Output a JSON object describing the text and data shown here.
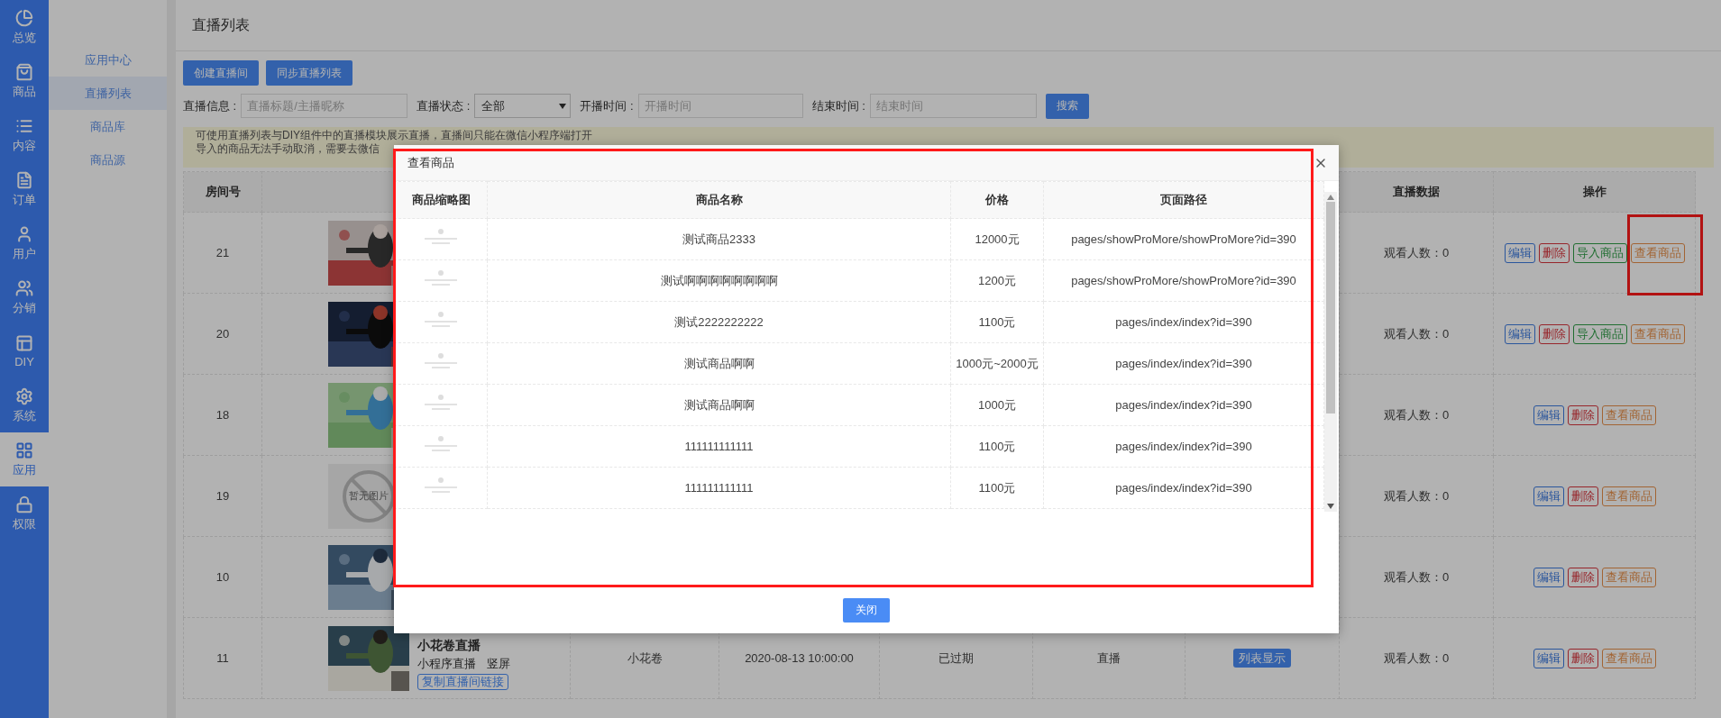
{
  "rail": [
    {
      "label": "总览",
      "selected": false
    },
    {
      "label": "商品",
      "selected": false
    },
    {
      "label": "内容",
      "selected": false
    },
    {
      "label": "订单",
      "selected": false
    },
    {
      "label": "用户",
      "selected": false
    },
    {
      "label": "分销",
      "selected": false
    },
    {
      "label": "DIY",
      "selected": false
    },
    {
      "label": "系统",
      "selected": false
    },
    {
      "label": "应用",
      "selected": true
    },
    {
      "label": "权限",
      "selected": false
    }
  ],
  "subnav": [
    {
      "label": "应用中心",
      "selected": false
    },
    {
      "label": "直播列表",
      "selected": true
    },
    {
      "label": "商品库",
      "selected": false
    },
    {
      "label": "商品源",
      "selected": false
    }
  ],
  "page": {
    "title": "直播列表"
  },
  "toolbar": [
    "创建直播间",
    "同步直播列表"
  ],
  "filters": {
    "info_label": "直播信息 :",
    "info_placeholder": "直播标题/主播昵称",
    "status_label": "直播状态 :",
    "status_value": "全部",
    "start_label": "开播时间 :",
    "start_placeholder": "开播时间",
    "end_label": "结束时间 :",
    "end_placeholder": "结束时间",
    "search": "搜索"
  },
  "notice": [
    "可使用直播列表与DIY组件中的直播模块展示直播，直播间只能在微信小程序端打开",
    "导入的商品无法手动取消，需要去微信"
  ],
  "table": {
    "columns": {
      "room": "房间号",
      "data": "直播数据",
      "ops": "操作"
    },
    "rows": [
      {
        "room": "21",
        "cover": {
          "kind": "picture"
        },
        "viewers": "观看人数：0",
        "actions": [
          {
            "kind": "edit",
            "label": "编辑",
            "framed": false
          },
          {
            "kind": "delete",
            "label": "删除",
            "framed": false
          },
          {
            "kind": "import",
            "label": "导入商品",
            "framed": false
          },
          {
            "kind": "view",
            "label": "查看商品",
            "framed": true
          }
        ]
      },
      {
        "room": "20",
        "cover": {
          "kind": "picture"
        },
        "viewers": "观看人数：0",
        "actions": [
          {
            "kind": "edit",
            "label": "编辑",
            "framed": false
          },
          {
            "kind": "delete",
            "label": "删除",
            "framed": false
          },
          {
            "kind": "import",
            "label": "导入商品",
            "framed": false
          },
          {
            "kind": "view",
            "label": "查看商品",
            "framed": false
          }
        ]
      },
      {
        "room": "18",
        "cover": {
          "kind": "picture"
        },
        "viewers": "观看人数：0",
        "actions": [
          {
            "kind": "edit",
            "label": "编辑",
            "framed": false
          },
          {
            "kind": "delete",
            "label": "删除",
            "framed": false
          },
          {
            "kind": "view",
            "label": "查看商品",
            "framed": false
          }
        ]
      },
      {
        "room": "19",
        "cover": {
          "kind": "placeholder",
          "text": "暂无图片"
        },
        "viewers": "观看人数：0",
        "actions": [
          {
            "kind": "edit",
            "label": "编辑",
            "framed": false
          },
          {
            "kind": "delete",
            "label": "删除",
            "framed": false
          },
          {
            "kind": "view",
            "label": "查看商品",
            "framed": false
          }
        ]
      },
      {
        "room": "10",
        "cover": {
          "kind": "picture"
        },
        "viewers": "观看人数：0",
        "actions": [
          {
            "kind": "edit",
            "label": "编辑",
            "framed": false
          },
          {
            "kind": "delete",
            "label": "删除",
            "framed": false
          },
          {
            "kind": "view",
            "label": "查看商品",
            "framed": false
          }
        ]
      },
      {
        "room": "11",
        "cover": {
          "kind": "picture"
        },
        "title": "小花卷直播",
        "tags": [
          "小程序直播",
          "竖屏"
        ],
        "link": "复制直播间链接",
        "anchor": "小花卷",
        "start_time": "2020-08-13 10:00:00",
        "status": "已过期",
        "type": "直播",
        "display": "列表显示",
        "viewers": "观看人数：0",
        "actions": [
          {
            "kind": "edit",
            "label": "编辑",
            "framed": false
          },
          {
            "kind": "delete",
            "label": "删除",
            "framed": false
          },
          {
            "kind": "view",
            "label": "查看商品",
            "framed": false
          }
        ]
      }
    ]
  },
  "modal": {
    "title": "查看商品",
    "framed": true,
    "columns": [
      "商品缩略图",
      "商品名称",
      "价格",
      "页面路径"
    ],
    "rows": [
      {
        "name": "测试商品2333",
        "price": "12000元",
        "path": "pages/showProMore/showProMore?id=390"
      },
      {
        "name": "测试啊啊啊啊啊啊啊啊",
        "price": "1200元",
        "path": "pages/showProMore/showProMore?id=390"
      },
      {
        "name": "测试2222222222",
        "price": "1100元",
        "path": "pages/index/index?id=390"
      },
      {
        "name": "测试商品啊啊",
        "price": "1000元~2000元",
        "path": "pages/index/index?id=390"
      },
      {
        "name": "测试商品啊啊",
        "price": "1000元",
        "path": "pages/index/index?id=390"
      },
      {
        "name": "111111111111",
        "price": "1100元",
        "path": "pages/index/index?id=390"
      },
      {
        "name": "111111111111",
        "price": "1100元",
        "path": "pages/index/index?id=390"
      }
    ],
    "close": "关闭"
  }
}
